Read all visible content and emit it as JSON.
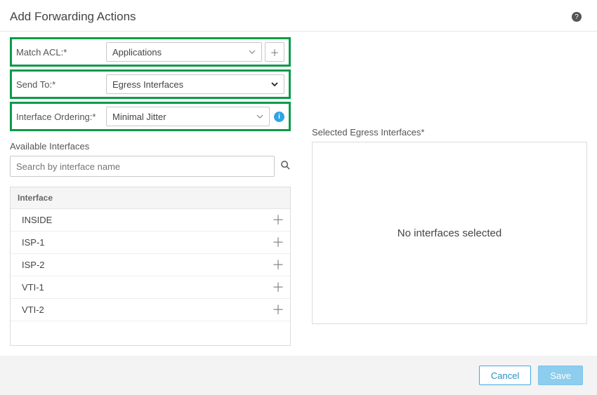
{
  "header": {
    "title": "Add Forwarding Actions"
  },
  "rows": {
    "matchAcl": {
      "label": "Match ACL:*",
      "value": "Applications"
    },
    "sendTo": {
      "label": "Send To:*",
      "value": "Egress Interfaces"
    },
    "ordering": {
      "label": "Interface Ordering:*",
      "value": "Minimal Jitter"
    }
  },
  "available": {
    "label": "Available Interfaces",
    "searchPlaceholder": "Search by interface name",
    "columnHeader": "Interface",
    "items": [
      "INSIDE",
      "ISP-1",
      "ISP-2",
      "VTI-1",
      "VTI-2"
    ]
  },
  "selected": {
    "label": "Selected Egress Interfaces*",
    "empty": "No interfaces selected"
  },
  "footer": {
    "cancel": "Cancel",
    "save": "Save"
  }
}
